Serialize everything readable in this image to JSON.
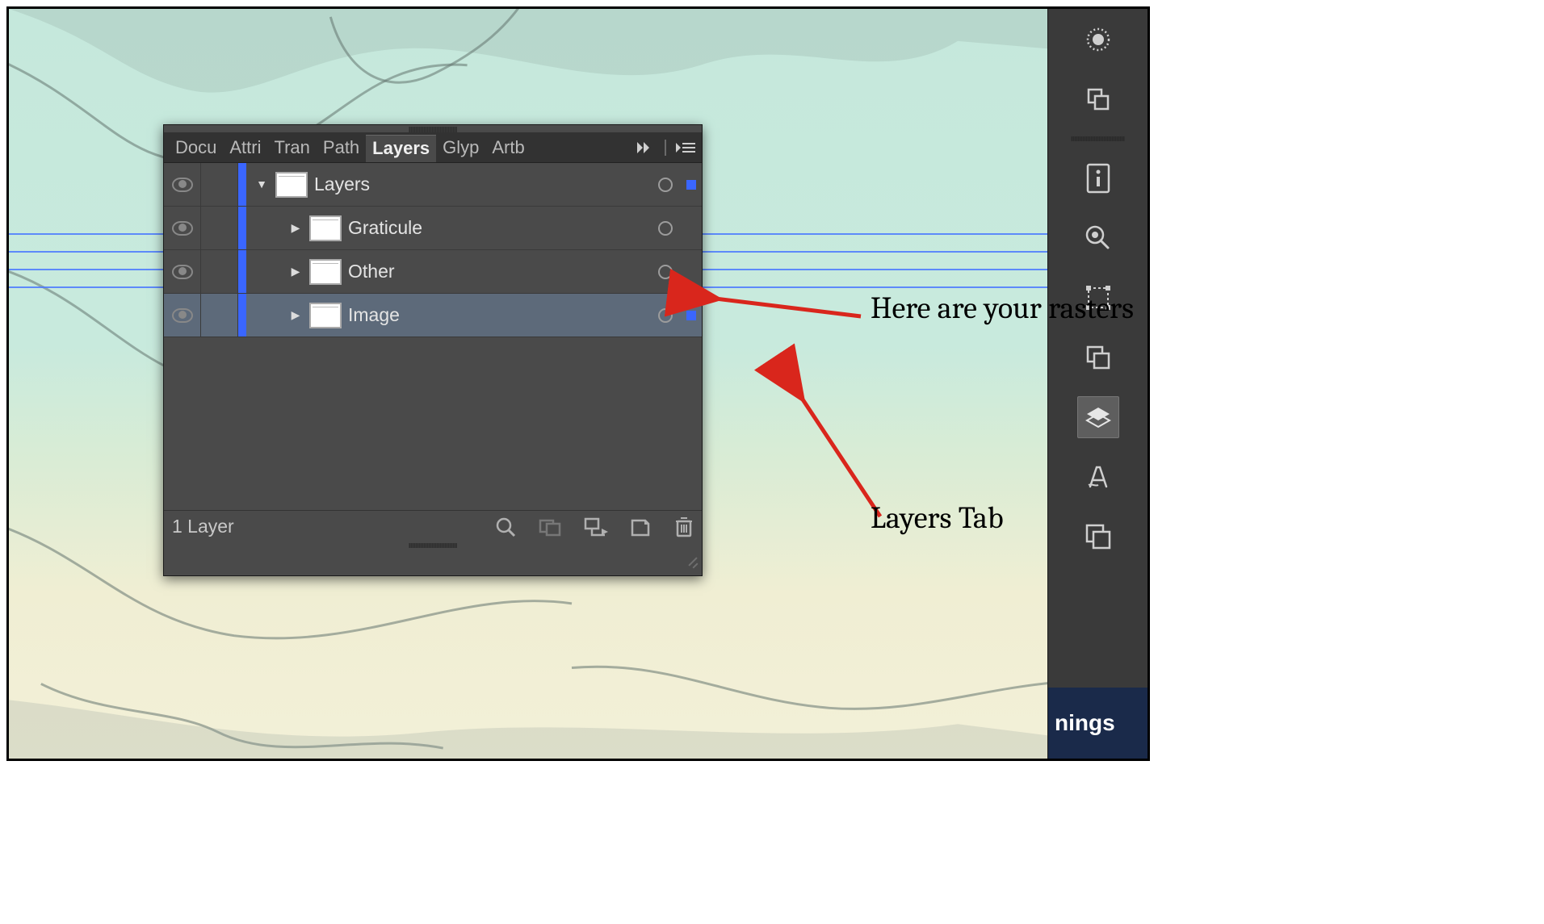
{
  "tabs": {
    "doc": "Docu",
    "attri": "Attri",
    "tran": "Tran",
    "path": "Path",
    "layers": "Layers",
    "glyp": "Glyp",
    "artb": "Artb"
  },
  "layers": {
    "root": {
      "name": "Layers"
    },
    "items": [
      {
        "name": "Graticule"
      },
      {
        "name": "Other"
      },
      {
        "name": "Image"
      }
    ]
  },
  "footer": {
    "count": "1 Layer"
  },
  "right_strip": {
    "bottom_text": "nings"
  },
  "annotations": {
    "rasters": "Here are your rasters",
    "layers_tab": "Layers Tab"
  }
}
